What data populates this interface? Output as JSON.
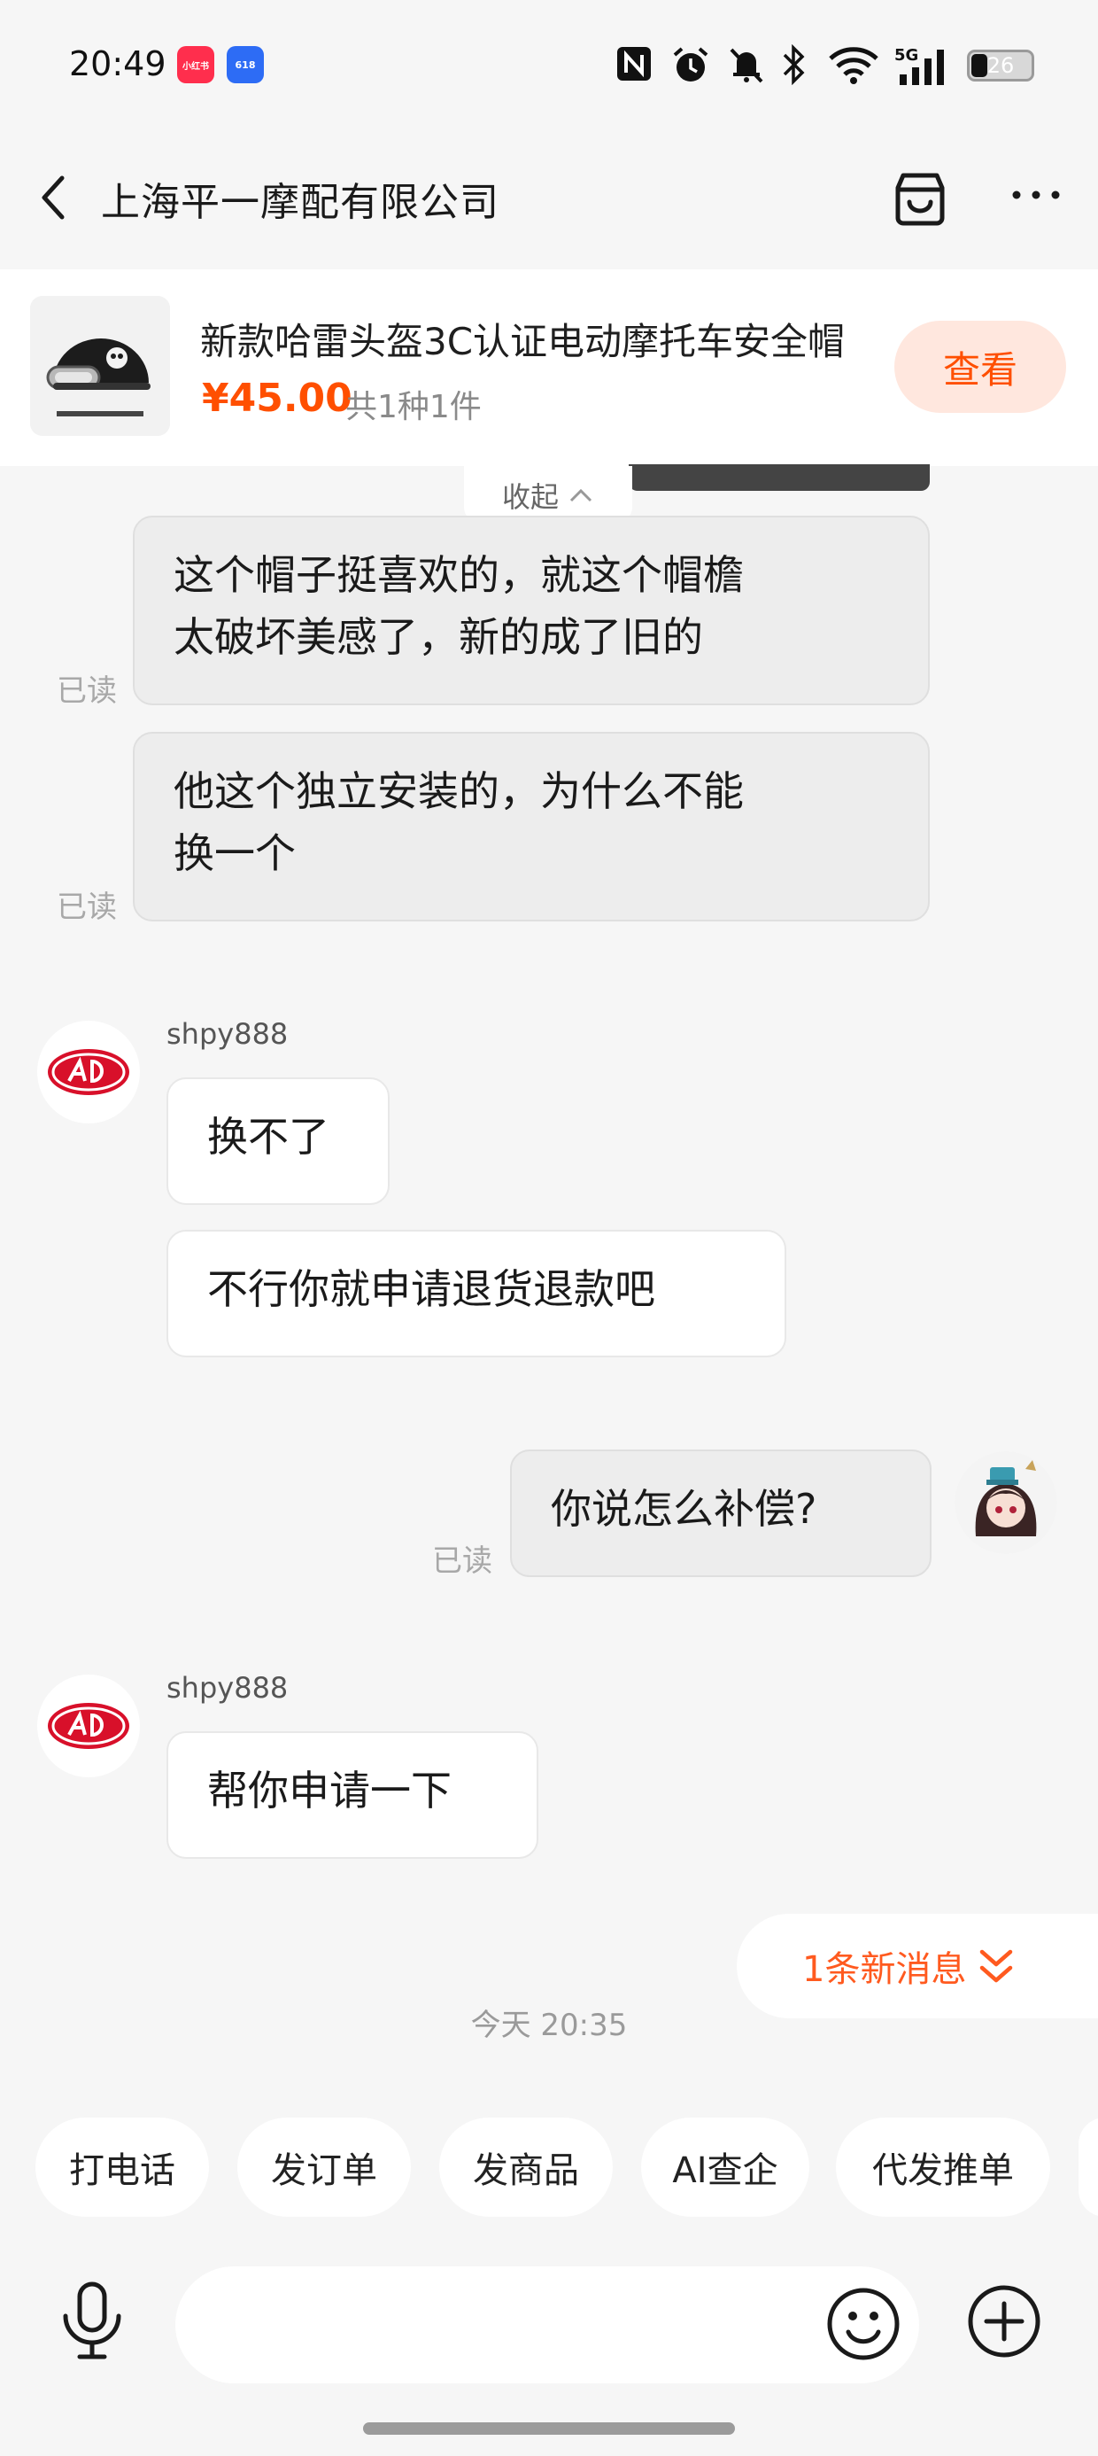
{
  "status_bar": {
    "time": "20:49",
    "app_badges": [
      "小红书",
      "618"
    ],
    "battery": "26",
    "network": "5G"
  },
  "header": {
    "title": "上海平一摩配有限公司"
  },
  "product": {
    "title": "新款哈雷头盔3C认证电动摩托车安全帽",
    "price": "¥45.00",
    "quantity": "共1种1件",
    "view_label": "查看"
  },
  "chat": {
    "collapse_label": "收起",
    "read_label": "已读",
    "messages": [
      {
        "side": "out",
        "text_line1": "这个帽子挺喜欢的，就这个帽檐",
        "text_line2": "太破坏美感了，新的成了旧的",
        "read": "已读"
      },
      {
        "side": "out",
        "text_line1": "他这个独立安装的，为什么不能",
        "text_line2": "换一个",
        "read": "已读"
      },
      {
        "side": "in",
        "sender": "shpy888",
        "text": "换不了"
      },
      {
        "side": "in",
        "text": "不行你就申请退货退款吧"
      },
      {
        "side": "out",
        "text": "你说怎么补偿?",
        "read": "已读"
      },
      {
        "side": "in",
        "sender": "shpy888",
        "text": "帮你申请一下"
      }
    ],
    "new_message_label": "1条新消息",
    "timestamp": "今天 20:35"
  },
  "quick_actions": [
    "打电话",
    "发订单",
    "发商品",
    "AI查企",
    "代发推单"
  ],
  "input": {
    "placeholder": ""
  },
  "colors": {
    "accent": "#ff4f00",
    "accent_light": "#ffe7de",
    "background": "#f6f6f6"
  },
  "icons": [
    "back-icon",
    "shop-icon",
    "more-icon",
    "mic-icon",
    "emoji-icon",
    "plus-icon",
    "chevron-up-icon",
    "double-chevron-down-icon"
  ]
}
